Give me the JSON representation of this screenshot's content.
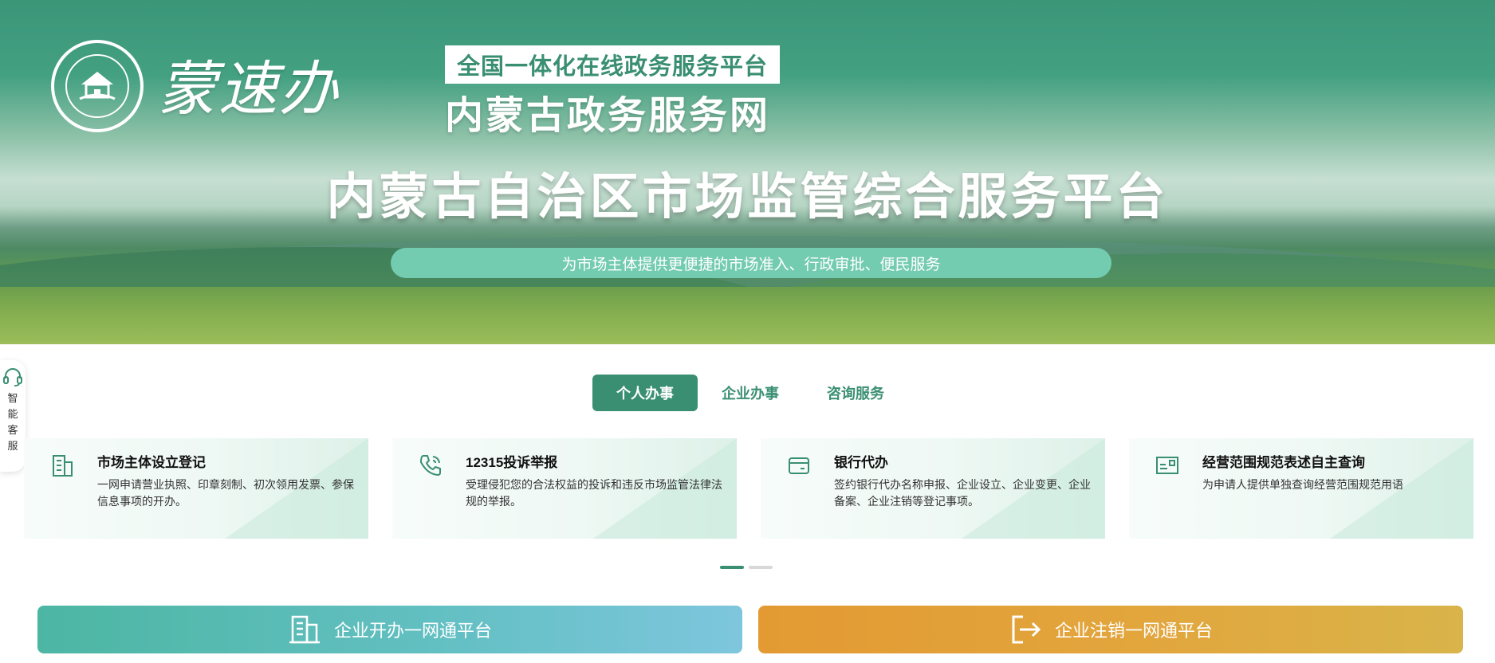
{
  "header": {
    "calligraphy_brand": "蒙速办",
    "subtitle": "全国一体化在线政务服务平台",
    "site_name": "内蒙古政务服务网",
    "platform_title": "内蒙古自治区市场监管综合服务平台",
    "slogan": "为市场主体提供更便捷的市场准入、行政审批、便民服务"
  },
  "side_service": {
    "label": "智能客服",
    "icon": "headset-icon"
  },
  "tabs": [
    {
      "label": "个人办事",
      "active": true
    },
    {
      "label": "企业办事",
      "active": false
    },
    {
      "label": "咨询服务",
      "active": false
    }
  ],
  "cards": [
    {
      "title": "市场主体设立登记",
      "desc": "一网申请营业执照、印章刻制、初次领用发票、参保信息事项的开办。",
      "icon": "building-icon"
    },
    {
      "title": "12315投诉举报",
      "desc": "受理侵犯您的合法权益的投诉和违反市场监管法律法规的举报。",
      "icon": "phone-icon"
    },
    {
      "title": "银行代办",
      "desc": "签约银行代办名称申报、企业设立、企业变更、企业备案、企业注销等登记事项。",
      "icon": "wallet-icon"
    },
    {
      "title": "经营范围规范表述自主查询",
      "desc": "为申请人提供单独查询经营范围规范用语",
      "icon": "id-card-icon"
    }
  ],
  "carousel": {
    "pages": 2,
    "current": 1
  },
  "bottom_buttons": {
    "open": {
      "label": "企业开办一网通平台",
      "icon": "building-icon",
      "color": "#4db6a3"
    },
    "close": {
      "label": "企业注销一网通平台",
      "icon": "exit-icon",
      "color": "#e39a33"
    }
  },
  "colors": {
    "primary": "#3a8f72",
    "accent_teal": "#73cbb0"
  }
}
